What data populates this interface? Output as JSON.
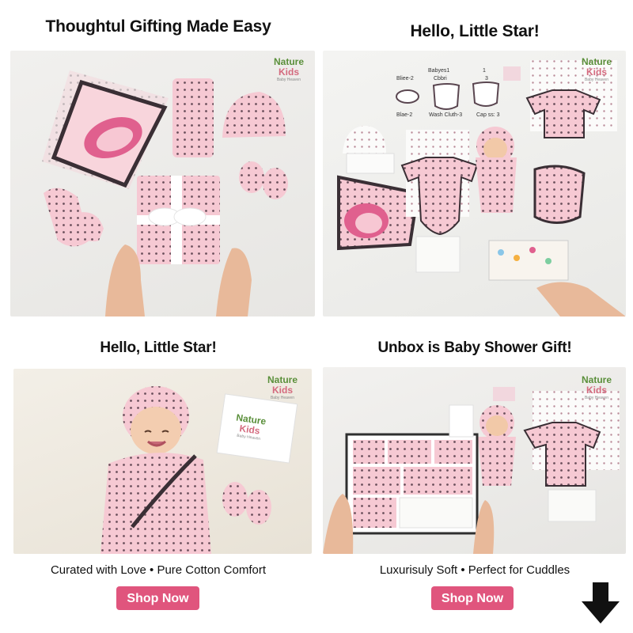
{
  "panels": [
    {
      "heading": "Thoughtul Gifting Made Easy",
      "logo": {
        "line1": "Nature",
        "line2": "Kids",
        "line3": "Baby Heaven"
      }
    },
    {
      "heading": "Hello, Little Star!",
      "logo": {
        "line1": "Nature",
        "line2": "Kids",
        "line3": "Baby Heaven"
      },
      "item_labels": [
        "Babyes1",
        "Bliee-2",
        "Cbbri",
        "1",
        "3",
        "Blae-2",
        "Wash Cluth-3",
        "Cap ss: 3"
      ]
    },
    {
      "heading": "Hello, Little Star!",
      "logo": {
        "line1": "Nature",
        "line2": "Kids",
        "line3": "Baby Heaven"
      },
      "card_logo": {
        "line1": "Nature",
        "line2": "Kids",
        "line3": "Baby Heaven"
      }
    },
    {
      "heading": "Unbox is Baby Shower Gift!",
      "logo": {
        "line1": "Nature",
        "line2": "Kids",
        "line3": "Baby Heaven"
      }
    }
  ],
  "taglines": [
    "Curated with Love • Pure Cotton Comfort",
    "Luxurisuly Soft • Perfect for Cuddles"
  ],
  "buttons": [
    "Shop Now",
    "Shop Now"
  ],
  "colors": {
    "button": "#e0557d",
    "product_pink": "#f6c9d3",
    "dot": "#6b4f5b",
    "trim": "#3a2f35"
  },
  "icons": {
    "scroll": "arrow-down-icon"
  }
}
